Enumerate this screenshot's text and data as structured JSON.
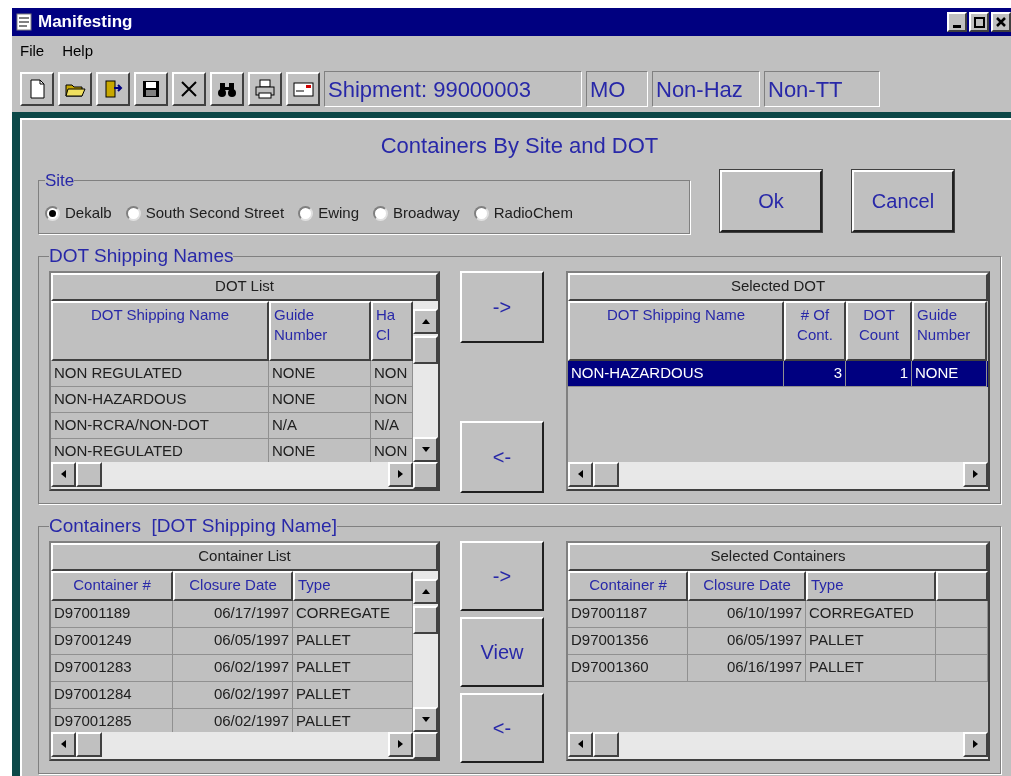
{
  "window": {
    "title": "Manifesting"
  },
  "menu": [
    "File",
    "Help"
  ],
  "status_panels": [
    "Shipment: 99000003",
    "MO",
    "Non-Haz",
    "Non-TT"
  ],
  "form_title": "Containers By Site and DOT",
  "site": {
    "label": "Site",
    "options": [
      {
        "label": "Dekalb",
        "selected": true
      },
      {
        "label": "South Second Street",
        "selected": false
      },
      {
        "label": "Ewing",
        "selected": false
      },
      {
        "label": "Broadway",
        "selected": false
      },
      {
        "label": "RadioChem",
        "selected": false
      }
    ]
  },
  "buttons": [
    "Ok",
    "Cancel"
  ],
  "dot_group": {
    "label": "DOT Shipping Names",
    "dot_list": {
      "title": "DOT List",
      "columns": [
        "DOT Shipping Name",
        "Guide\nNumber",
        "Ha\nCl"
      ],
      "rows": [
        {
          "cells": [
            "NON REGULATED",
            "NONE",
            "NON"
          ],
          "selected": false
        },
        {
          "cells": [
            "NON-HAZARDOUS",
            "NONE",
            "NON"
          ],
          "selected": false
        },
        {
          "cells": [
            "NON-RCRA/NON-DOT",
            "N/A",
            "N/A"
          ],
          "selected": false
        },
        {
          "cells": [
            "NON-REGULATED",
            "NONE",
            "NON"
          ],
          "selected": false
        }
      ]
    },
    "move_buttons": [
      "->",
      "<-"
    ],
    "selected_dot": {
      "title": "Selected DOT",
      "columns": [
        "DOT Shipping Name",
        "# Of\nCont.",
        "DOT\nCount",
        "Guide\nNumber"
      ],
      "rows": [
        {
          "cells": [
            "NON-HAZARDOUS",
            "3",
            "1",
            "NONE"
          ],
          "selected": true
        }
      ]
    }
  },
  "containers_group": {
    "label": "Containers  [DOT Shipping Name]",
    "container_list": {
      "title": "Container List",
      "columns": [
        "Container #",
        "Closure Date",
        "Type"
      ],
      "rows": [
        {
          "cells": [
            "D97001189",
            "06/17/1997",
            "CORREGATE"
          ],
          "selected": false
        },
        {
          "cells": [
            "D97001249",
            "06/05/1997",
            "PALLET"
          ],
          "selected": false
        },
        {
          "cells": [
            "D97001283",
            "06/02/1997",
            "PALLET"
          ],
          "selected": false
        },
        {
          "cells": [
            "D97001284",
            "06/02/1997",
            "PALLET"
          ],
          "selected": false
        },
        {
          "cells": [
            "D97001285",
            "06/02/1997",
            "PALLET"
          ],
          "selected": false
        }
      ]
    },
    "move_buttons": [
      "->",
      "View",
      "<-"
    ],
    "selected_containers": {
      "title": "Selected Containers",
      "columns": [
        "Container #",
        "Closure Date",
        "Type",
        ""
      ],
      "rows": [
        {
          "cells": [
            "D97001187",
            "06/10/1997",
            "CORREGATED"
          ],
          "selected": false
        },
        {
          "cells": [
            "D97001356",
            "06/05/1997",
            "PALLET"
          ],
          "selected": false
        },
        {
          "cells": [
            "D97001360",
            "06/16/1997",
            "PALLET"
          ],
          "selected": false
        }
      ]
    }
  }
}
